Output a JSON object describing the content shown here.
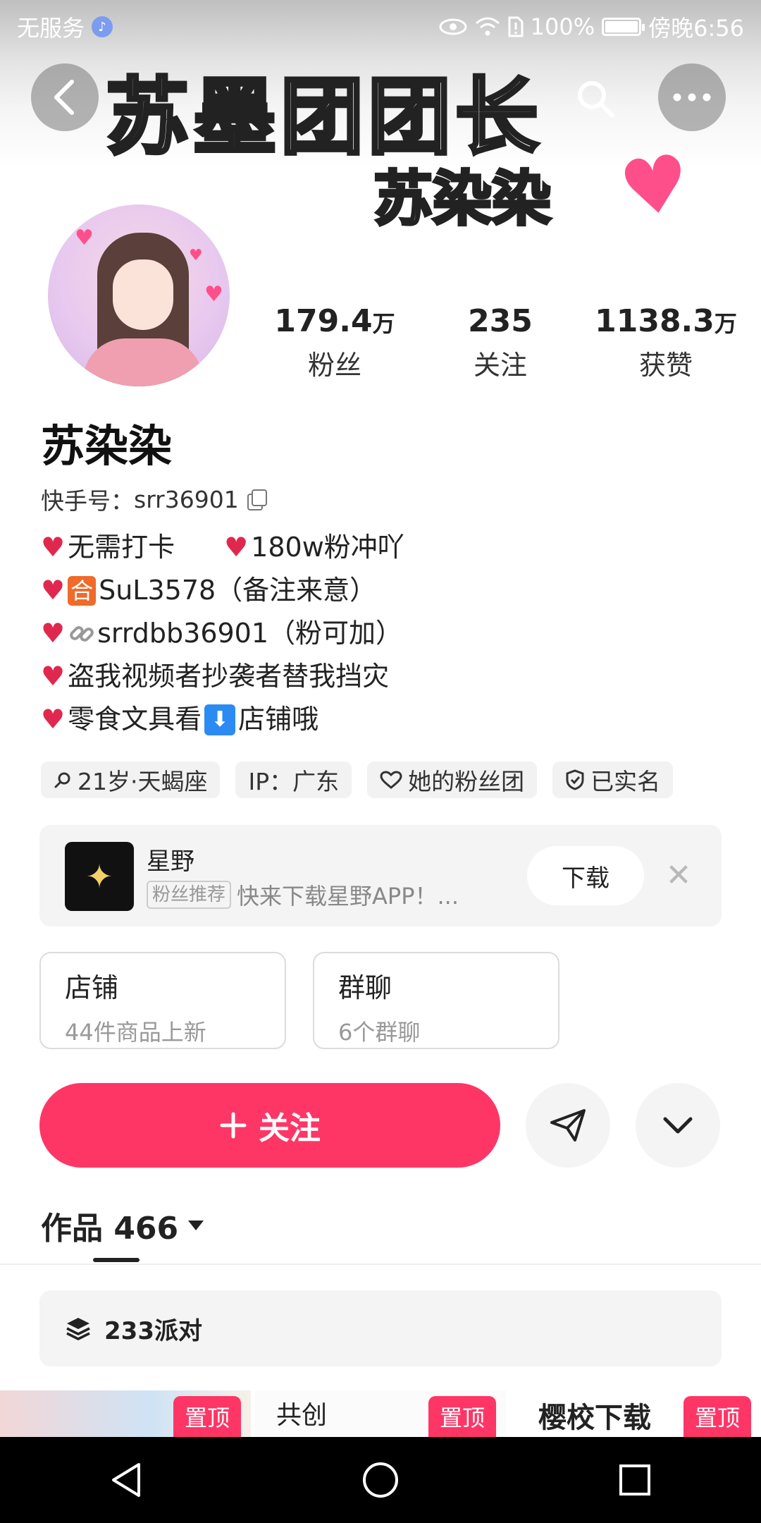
{
  "status_bar": {
    "carrier": "无服务",
    "battery": "100%",
    "time": "傍晚6:56"
  },
  "banner": {
    "title": "苏墨团团长",
    "subtitle": "苏染染"
  },
  "stats": [
    {
      "value": "179.4",
      "unit": "万",
      "label": "粉丝"
    },
    {
      "value": "235",
      "unit": "",
      "label": "关注"
    },
    {
      "value": "1138.3",
      "unit": "万",
      "label": "获赞"
    }
  ],
  "profile": {
    "name": "苏染染",
    "id_label": "快手号：",
    "id_value": "srr36901"
  },
  "bio": {
    "line1_a": "无需打卡",
    "line1_b": "180w粉冲吖",
    "line2_badge": "合",
    "line2_text": "SuL3578（备注来意）",
    "line3_text": "srrdbb36901（粉可加）",
    "line4_text": "盗我视频者抄袭者替我挡灾",
    "line5_a": "零食文具看",
    "line5_badge": "⬇",
    "line5_b": "店铺哦"
  },
  "tags": [
    "21岁·天蝎座",
    "IP：广东",
    "她的粉丝团",
    "已实名"
  ],
  "promo": {
    "app_name": "星野",
    "badge": "粉丝推荐",
    "description": "快来下载星野APP！...",
    "download_label": "下载"
  },
  "cards": [
    {
      "title": "店铺",
      "subtitle": "44件商品上新"
    },
    {
      "title": "群聊",
      "subtitle": "6个群聊"
    }
  ],
  "actions": {
    "follow_label": "关注"
  },
  "works": {
    "label": "作品 466"
  },
  "collection": {
    "label": "233派对"
  },
  "thumbnails": [
    {
      "pin": "置顶",
      "text": ""
    },
    {
      "pin": "置顶",
      "text": "共创"
    },
    {
      "pin": "置顶",
      "text": "樱校下载"
    }
  ],
  "colors": {
    "accent": "#fe3666",
    "card_bg": "#f4f4f4"
  }
}
